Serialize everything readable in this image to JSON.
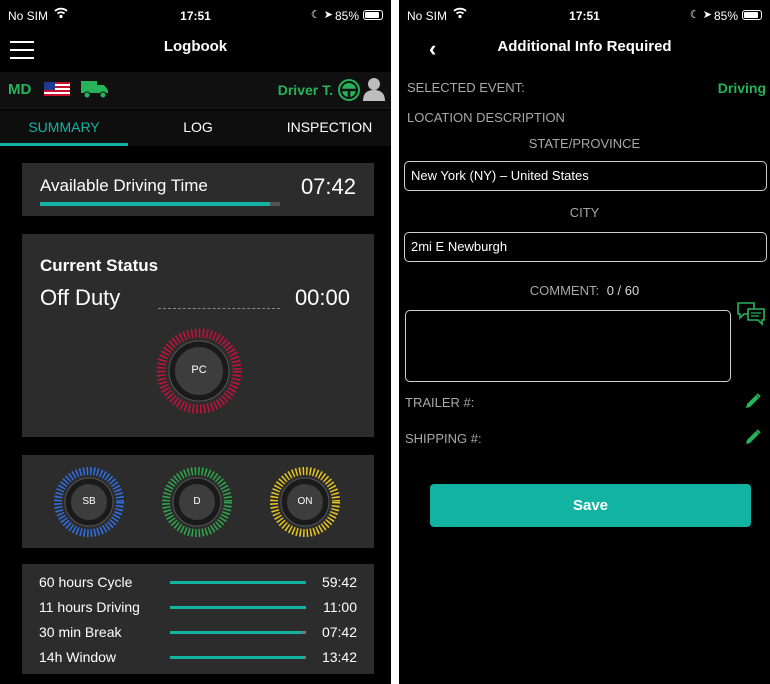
{
  "colors": {
    "accent": "#12b3a2",
    "green": "#26b35a",
    "pc": "#c0123a",
    "sb": "#2f6fe8",
    "d": "#2ea84a",
    "on": "#e6c51f"
  },
  "status_bar_left": {
    "carrier": "No SIM",
    "time": "17:51",
    "battery": "85%"
  },
  "status_bar_right": {
    "carrier": "No SIM",
    "time": "17:51",
    "battery": "85%"
  },
  "logbook": {
    "title": "Logbook",
    "state": "MD",
    "driver": "Driver T.",
    "tabs": [
      "SUMMARY",
      "LOG",
      "INSPECTION"
    ],
    "available": {
      "label": "Available Driving Time",
      "value": "07:42",
      "fill": 0.96
    },
    "current_status": {
      "heading": "Current Status",
      "status": "Off Duty",
      "time": "00:00"
    },
    "dials": {
      "pc": "PC",
      "sb": "SB",
      "d": "D",
      "on": "ON"
    },
    "hours": [
      {
        "label": "60 hours Cycle",
        "value": "59:42",
        "fill": 0.99
      },
      {
        "label": "11 hours Driving",
        "value": "11:00",
        "fill": 1.0
      },
      {
        "label": "30 min Break",
        "value": "07:42",
        "fill": 0.97
      },
      {
        "label": "14h Window",
        "value": "13:42",
        "fill": 0.98
      }
    ]
  },
  "info": {
    "title": "Additional Info Required",
    "selected_event_label": "SELECTED EVENT:",
    "selected_event_value": "Driving",
    "location_label": "LOCATION DESCRIPTION",
    "state_label": "STATE/PROVINCE",
    "state_value": "New York (NY) – United States",
    "city_label": "CITY",
    "city_value": "2mi E Newburgh",
    "comment_label": "COMMENT:",
    "comment_count": "0 / 60",
    "comment_value": "",
    "trailer_label": "TRAILER #:",
    "shipping_label": "SHIPPING #:",
    "save_label": "Save"
  }
}
